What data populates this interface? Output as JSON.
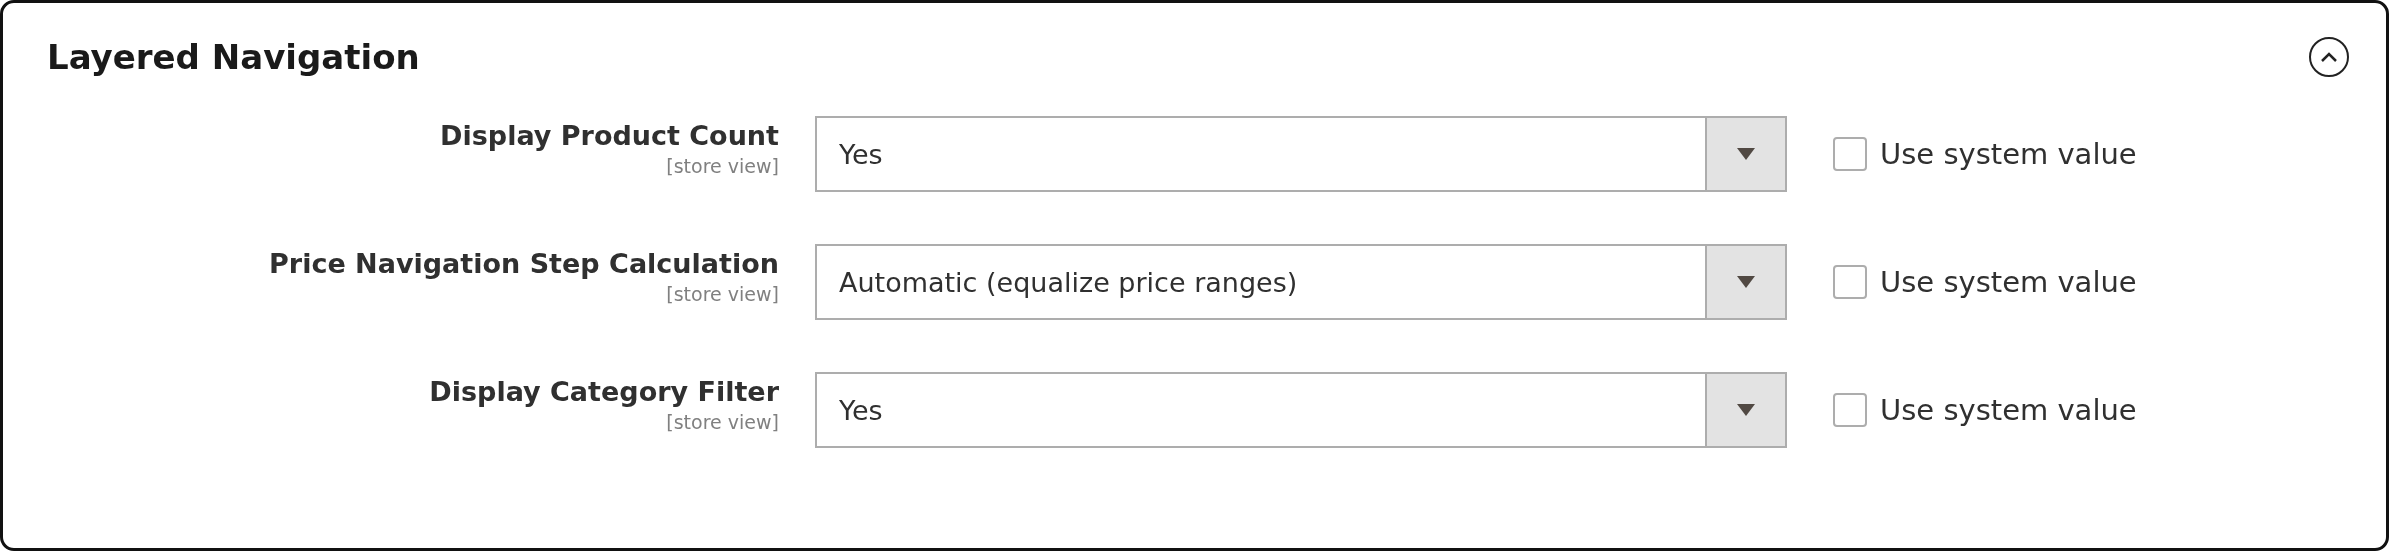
{
  "section": {
    "title": "Layered Navigation",
    "expanded": true
  },
  "fields": [
    {
      "label": "Display Product Count",
      "scope": "[store view]",
      "value": "Yes",
      "use_system_value": {
        "label": "Use system value",
        "checked": false
      }
    },
    {
      "label": "Price Navigation Step Calculation",
      "scope": "[store view]",
      "value": "Automatic (equalize price ranges)",
      "use_system_value": {
        "label": "Use system value",
        "checked": false
      }
    },
    {
      "label": "Display Category Filter",
      "scope": "[store view]",
      "value": "Yes",
      "use_system_value": {
        "label": "Use system value",
        "checked": false
      }
    }
  ]
}
